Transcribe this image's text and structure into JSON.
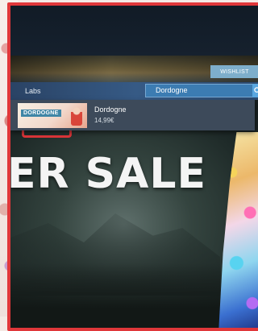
{
  "store": {
    "wishlist_label": "WISHLIST",
    "nav_item": "Labs"
  },
  "search": {
    "value": "Dordogne"
  },
  "suggestion": {
    "name": "Dordogne",
    "price": "14,99€",
    "thumb_title": "DORDOGNE"
  },
  "hero": {
    "sale_text": "ER SALE"
  },
  "colors": {
    "frame_border": "#e0373a",
    "navbar": "#365a85",
    "search_box": "#3c7cb2",
    "wishlist": "#7eaecb"
  }
}
